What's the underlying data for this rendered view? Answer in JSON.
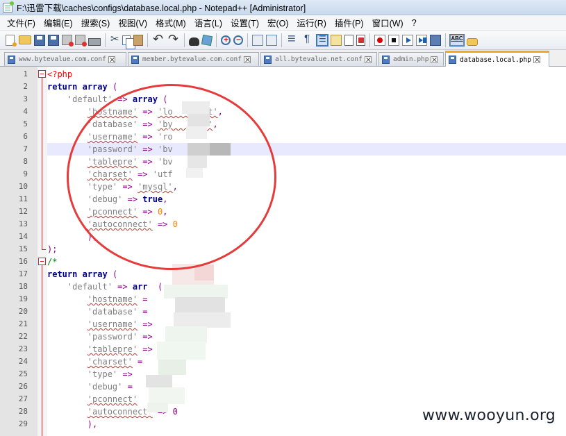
{
  "window": {
    "title": "F:\\迅雷下载\\caches\\configs\\database.local.php - Notepad++ [Administrator]"
  },
  "menu": {
    "items": [
      "文件(F)",
      "编辑(E)",
      "搜索(S)",
      "视图(V)",
      "格式(M)",
      "语言(L)",
      "设置(T)",
      "宏(O)",
      "运行(R)",
      "插件(P)",
      "窗口(W)",
      "?"
    ]
  },
  "toolbar": {
    "icons": [
      "new-file-icon",
      "open-file-icon",
      "save-icon",
      "save-all-icon",
      "close-icon",
      "close-all-icon",
      "print-icon",
      "cut-icon",
      "copy-icon",
      "paste-icon",
      "undo-icon",
      "redo-icon",
      "find-icon",
      "replace-icon",
      "zoom-in-icon",
      "zoom-out-icon",
      "sync-vertical-icon",
      "sync-horizontal-icon",
      "word-wrap-icon",
      "show-all-chars-icon",
      "indent-guide-icon",
      "language-icon",
      "doc-map-icon",
      "function-list-icon",
      "record-macro-icon",
      "stop-record-icon",
      "play-macro-icon",
      "run-macro-multiple-icon",
      "save-macro-icon",
      "spell-check-icon",
      "plugin-icon"
    ]
  },
  "tabs": [
    {
      "label": "www.bytevalue.com.conf",
      "active": false
    },
    {
      "label": "member.bytevalue.com.conf",
      "active": false
    },
    {
      "label": "all.bytevalue.net.conf",
      "active": false
    },
    {
      "label": "admin.php",
      "active": false
    },
    {
      "label": "database.local.php",
      "active": true
    }
  ],
  "editor": {
    "line_numbers": [
      "1",
      "2",
      "3",
      "4",
      "5",
      "6",
      "7",
      "8",
      "9",
      "10",
      "11",
      "12",
      "13",
      "14",
      "15",
      "16",
      "17",
      "18",
      "19",
      "20",
      "21",
      "22",
      "23",
      "24",
      "25",
      "26",
      "27",
      "28",
      "29"
    ],
    "highlighted_line": 7,
    "code": {
      "l1_tag": "<?php",
      "l2_return": "return",
      "l2_array": "array",
      "l2_paren": " (",
      "l3_key": "'default'",
      "l3_arrow": "=>",
      "l3_array": "array",
      "l3_paren": " (",
      "l4_key": "'hostname'",
      "l4_val": "'lo     ost'",
      "l5_key": "'database'",
      "l5_val": "'by    lue'",
      "l6_key": "'username'",
      "l6_val": "'ro",
      "l7_key": "'password'",
      "l7_val": "'bv    @!23'",
      "l8_key": "'tablepre'",
      "l8_val": "'bv",
      "l9_key": "'charset'",
      "l9_val": "'utf",
      "l10_key": "'type'",
      "l10_val": "'mysql'",
      "l11_key": "'debug'",
      "l11_val": "true",
      "l12_key": "'pconnect'",
      "l12_val": "0",
      "l13_key": "'autoconnect'",
      "l13_val": "0",
      "l14_close": "),",
      "l15_close": ");",
      "l16_comment": "/*",
      "l17_return": "return",
      "l17_array": "array",
      "l17_paren": " (",
      "l18_key": "'default'",
      "l18_arrow": "=>",
      "l18_array": "arr",
      "l18_paren": "  (",
      "l19_key": "'hostname'",
      "l19_tail": " =",
      "l20_key": "'database'",
      "l20_tail": " =",
      "l21_key": "'username'",
      "l21_tail": " =>",
      "l22_key": "'password'",
      "l22_tail": " =>",
      "l23_key": "'tablepre'",
      "l23_tail": " =>",
      "l24_key": "'charset'",
      "l24_tail": " =",
      "l25_key": "'type'",
      "l25_tail": " =>",
      "l26_key": "'debug'",
      "l26_tail": " =",
      "l27_key": "'pconnect'",
      "l27_tail": " ",
      "l28_key": "'autoconnect'",
      "l28_tail": " => 0",
      "l29_close": "),"
    },
    "comma": ","
  },
  "colors": {
    "keyword": "#00008b",
    "php_tag": "#ff0000",
    "string": "#808080",
    "operator": "#8b008b",
    "number": "#ff8000",
    "comment": "#008000",
    "fold_marker": "#e02020",
    "annotation_circle": "#e53b3b",
    "active_tab_accent": "#f5a623"
  },
  "watermark": "www.wooyun.org"
}
